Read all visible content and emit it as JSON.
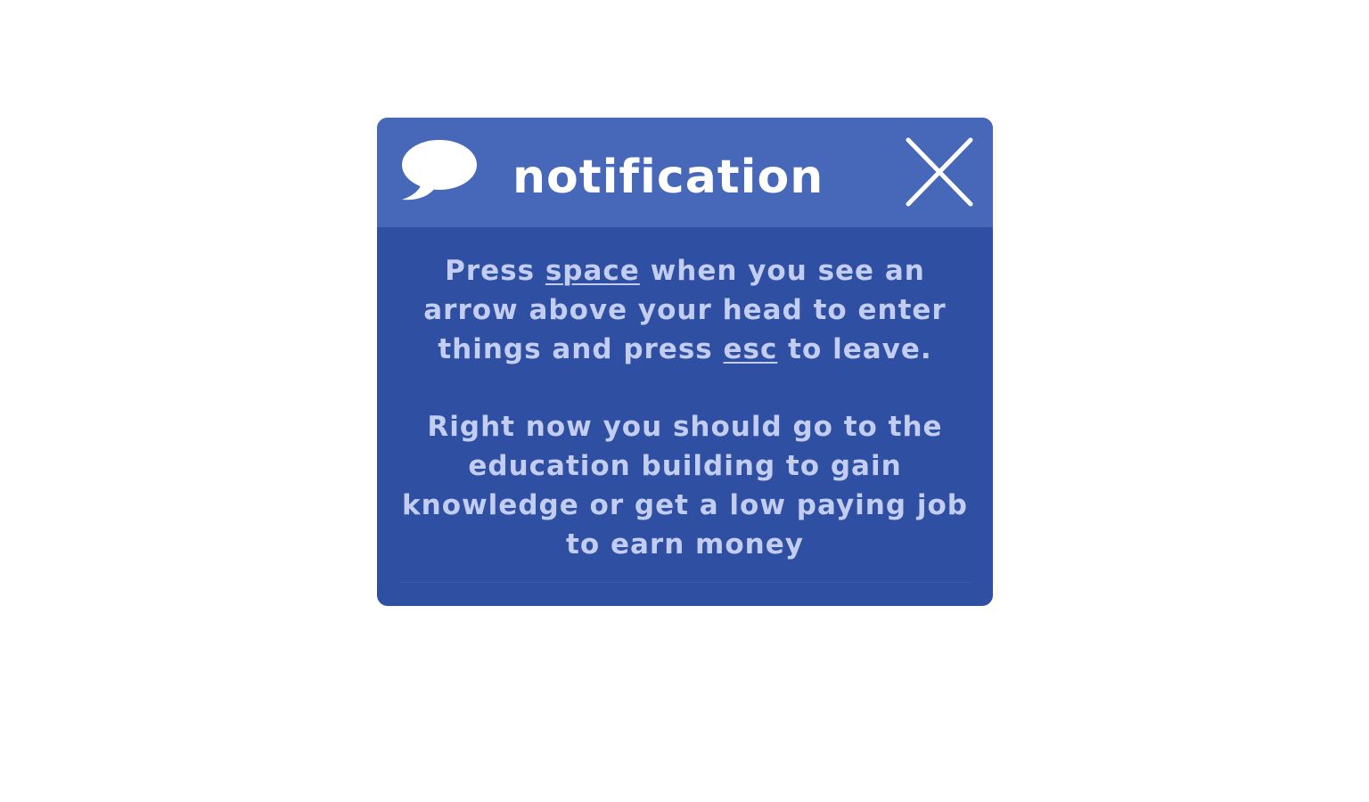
{
  "notification": {
    "title": "notification",
    "header_icon": "speech-bubble-icon",
    "close_icon": "close-icon",
    "message_1": {
      "part_1": "Press ",
      "key_1": "space",
      "part_2": " when you see an arrow above your head to enter things and press ",
      "key_2": "esc",
      "part_3": " to leave."
    },
    "message_2": "Right now you should go to the education building to gain knowledge or get a low paying job to earn money"
  },
  "colors": {
    "header_background": "#4767b9",
    "body_background": "#2f4fa2",
    "title_text": "#ffffff",
    "body_text": "#c3cdf0",
    "page_background": "#ffffff"
  }
}
